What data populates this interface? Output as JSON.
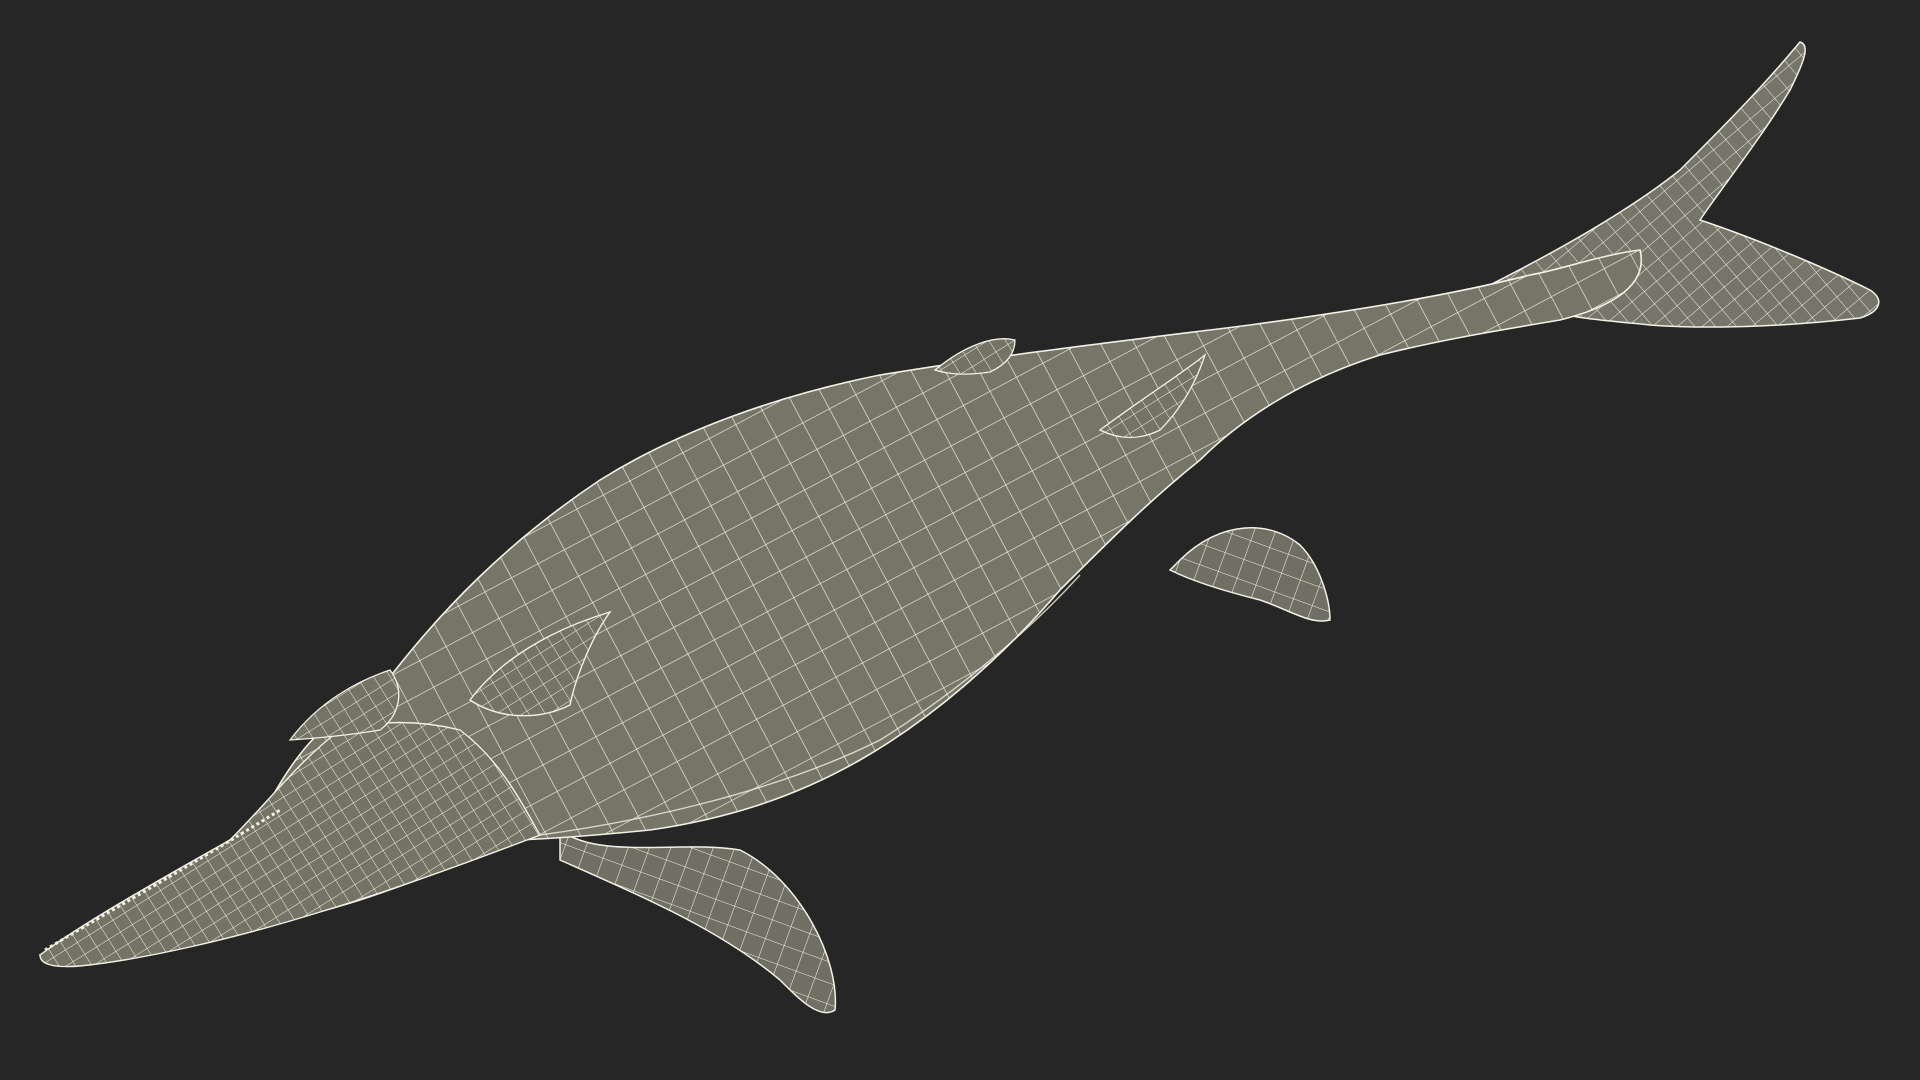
{
  "scene": {
    "subject": "ichthyosaur-wireframe-model",
    "colors": {
      "background": "#262626",
      "surface": "#757568",
      "wire": "#f3f1e4",
      "shade": "#5f5f54"
    }
  }
}
